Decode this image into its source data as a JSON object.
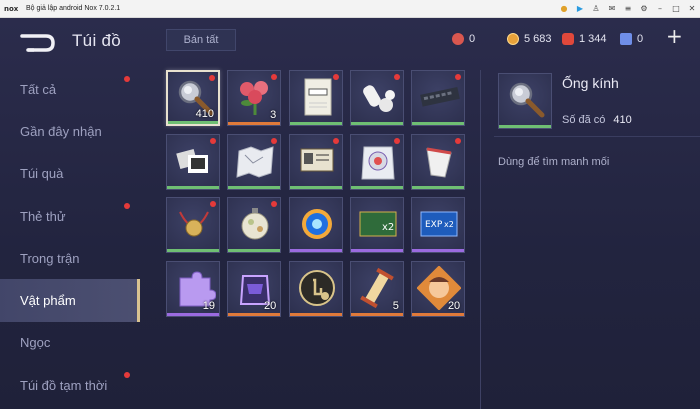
{
  "emulator": {
    "logo": "nox",
    "title": "Bộ giả lập android Nox 7.0.2.1",
    "controls": [
      "rocket-icon",
      "play-icon",
      "user-icon",
      "mail-icon",
      "menu-icon",
      "gear-icon",
      "minimize-icon",
      "maximize-icon",
      "close-icon"
    ]
  },
  "header": {
    "title": "Túi đồ",
    "sell_all": "Bán tất",
    "currencies": [
      {
        "icon": "heart-gem-icon",
        "value": "0",
        "color": "#d9574f"
      },
      {
        "icon": "gold-coin-icon",
        "value": "5 683",
        "color": "#e8a23a"
      },
      {
        "icon": "red-gem-icon",
        "value": "1 344",
        "color": "#e0483b"
      },
      {
        "icon": "blue-voucher-icon",
        "value": "0",
        "color": "#6f8ee8"
      }
    ],
    "plus": "+"
  },
  "sidebar": {
    "items": [
      {
        "label": "Tất cả",
        "dot": true,
        "active": false
      },
      {
        "label": "Gần đây nhận",
        "dot": false,
        "active": false
      },
      {
        "label": "Túi quà",
        "dot": false,
        "active": false
      },
      {
        "label": "Thẻ thử",
        "dot": true,
        "active": false
      },
      {
        "label": "Trong trận",
        "dot": false,
        "active": false
      },
      {
        "label": "Vật phẩm",
        "dot": false,
        "active": true
      },
      {
        "label": "Ngọc",
        "dot": false,
        "active": false
      },
      {
        "label": "Túi đồ tạm thời",
        "dot": true,
        "active": false
      }
    ]
  },
  "items": [
    {
      "icon": "magnifier-icon",
      "count": "410",
      "dot": true,
      "bar": "#6fbf73"
    },
    {
      "icon": "roses-icon",
      "count": "3",
      "dot": true,
      "bar": "#e07a3a"
    },
    {
      "icon": "notebook-icon",
      "count": "",
      "dot": true,
      "bar": "#6fbf73"
    },
    {
      "icon": "pills-icon",
      "count": "",
      "dot": true,
      "bar": "#6fbf73"
    },
    {
      "icon": "keyboard-icon",
      "count": "",
      "dot": true,
      "bar": "#6fbf73"
    },
    {
      "icon": "photos-icon",
      "count": "",
      "dot": true,
      "bar": "#6fbf73"
    },
    {
      "icon": "map-icon",
      "count": "",
      "dot": true,
      "bar": "#6fbf73"
    },
    {
      "icon": "id-card-icon",
      "count": "",
      "dot": true,
      "bar": "#6fbf73"
    },
    {
      "icon": "badge-bag-icon",
      "count": "",
      "dot": true,
      "bar": "#6fbf73"
    },
    {
      "icon": "cup-icon",
      "count": "",
      "dot": true,
      "bar": "#6fbf73"
    },
    {
      "icon": "medal-icon",
      "count": "",
      "dot": true,
      "bar": "#6fbf73"
    },
    {
      "icon": "ornament-icon",
      "count": "",
      "dot": true,
      "bar": "#6fbf73"
    },
    {
      "icon": "blue-orb-icon",
      "count": "",
      "dot": false,
      "bar": "#9b6be0"
    },
    {
      "icon": "gold-x2-card-icon",
      "count": "",
      "dot": false,
      "bar": "#9b6be0"
    },
    {
      "icon": "exp-x2-card-icon",
      "count": "",
      "dot": false,
      "bar": "#9b6be0"
    },
    {
      "icon": "puzzle-icon",
      "count": "19",
      "dot": false,
      "bar": "#9b6be0"
    },
    {
      "icon": "helmet-icon",
      "count": "20",
      "dot": false,
      "bar": "#e07a3a"
    },
    {
      "icon": "hand-badge-icon",
      "count": "",
      "dot": false,
      "bar": "#e07a3a"
    },
    {
      "icon": "scroll-icon",
      "count": "5",
      "dot": false,
      "bar": "#e07a3a"
    },
    {
      "icon": "portrait-icon",
      "count": "20",
      "dot": false,
      "bar": "#e07a3a"
    }
  ],
  "detail": {
    "icon": "magnifier-icon",
    "name": "Ống kính",
    "owned_label": "Số đã có",
    "owned_value": "410",
    "description": "Dùng để tìm manh mối"
  }
}
